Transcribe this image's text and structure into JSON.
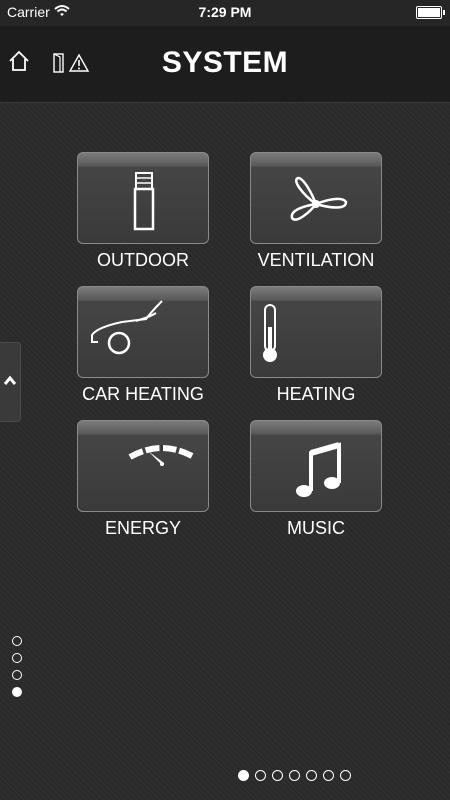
{
  "status_bar": {
    "carrier": "Carrier",
    "time": "7:29 PM"
  },
  "header": {
    "title": "SYSTEM"
  },
  "tiles": [
    {
      "label": "OUTDOOR",
      "icon": "outdoor-lamp-icon"
    },
    {
      "label": "VENTILATION",
      "icon": "fan-icon"
    },
    {
      "label": "CAR HEATING",
      "icon": "car-icon"
    },
    {
      "label": "HEATING",
      "icon": "thermometer-icon"
    },
    {
      "label": "ENERGY",
      "icon": "gauge-icon"
    },
    {
      "label": "MUSIC",
      "icon": "music-note-icon"
    }
  ],
  "vertical_pager": {
    "count": 4,
    "active_index": 3
  },
  "horizontal_pager": {
    "count": 7,
    "active_index": 0
  }
}
